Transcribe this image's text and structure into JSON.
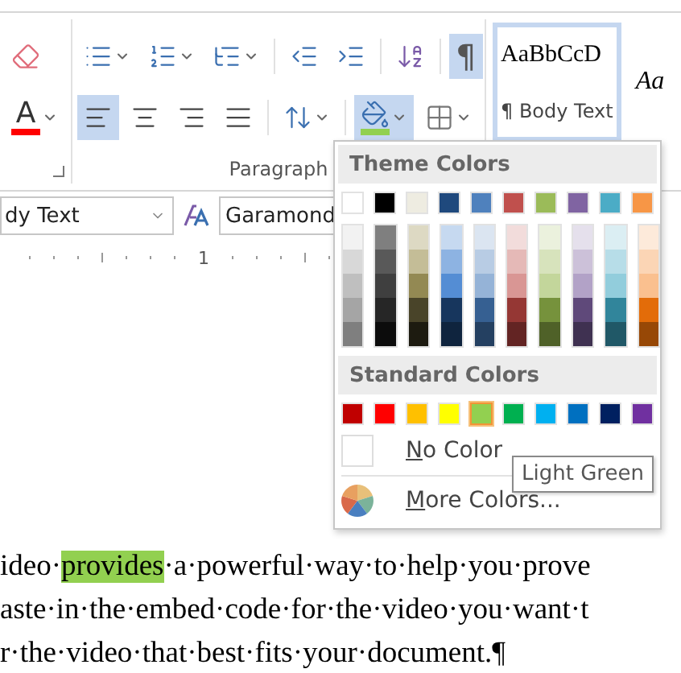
{
  "ribbon": {
    "left_group": {
      "row1": [
        {
          "kind": "clear_formatting",
          "selected": false
        }
      ],
      "row2": [
        {
          "kind": "font_color",
          "glyph": "A",
          "selected": false
        }
      ]
    },
    "paragraph_group": {
      "label": "Paragraph",
      "row1": [
        {
          "kind": "bullets",
          "selected": false
        },
        {
          "kind": "numbering",
          "selected": false
        },
        {
          "kind": "multilevel",
          "selected": false
        },
        {
          "kind": "decrease_indent",
          "selected": false
        },
        {
          "kind": "increase_indent",
          "selected": false
        },
        {
          "kind": "sort",
          "selected": false
        },
        {
          "kind": "show_hide",
          "glyph": "¶",
          "selected": true
        }
      ],
      "row2": [
        {
          "kind": "align_left",
          "selected": true
        },
        {
          "kind": "align_center",
          "selected": false
        },
        {
          "kind": "align_right",
          "selected": false
        },
        {
          "kind": "justify",
          "selected": false
        },
        {
          "kind": "line_spacing",
          "selected": false
        },
        {
          "kind": "shading",
          "selected": true
        },
        {
          "kind": "borders",
          "selected": false
        }
      ]
    },
    "styles": [
      {
        "preview": "AaBbCcD",
        "name": "¶ Body Text",
        "selected": true
      },
      {
        "preview": "Aa",
        "selected": false
      }
    ]
  },
  "font_row": {
    "style_box": "dy Text",
    "font_box": "Garamond"
  },
  "ruler": {
    "mark": "1"
  },
  "document": {
    "lines": [
      [
        {
          "text": "ideo·",
          "highlight": false
        },
        {
          "text": "provides",
          "highlight": true
        },
        {
          "text": "·a·powerful·way·to·help·you·prove",
          "highlight": false
        }
      ],
      [
        {
          "text": "aste·in·the·embed·code·for·the·video·you·want·t",
          "highlight": false
        }
      ],
      [
        {
          "text": "r·the·video·that·best·fits·your·document.¶",
          "highlight": false
        }
      ]
    ]
  },
  "color_menu": {
    "theme_title": "Theme Colors",
    "theme_colors": [
      {
        "color": "#ffffff",
        "shades": [
          {
            "color": "#f2f2f2"
          },
          {
            "color": "#d8d8d8"
          },
          {
            "color": "#bfbfbf"
          },
          {
            "color": "#a5a5a5"
          },
          {
            "color": "#7f7f7f"
          }
        ]
      },
      {
        "color": "#000000",
        "shades": [
          {
            "color": "#7f7f7f"
          },
          {
            "color": "#595959"
          },
          {
            "color": "#3f3f3f"
          },
          {
            "color": "#262626"
          },
          {
            "color": "#0c0c0c"
          }
        ]
      },
      {
        "color": "#eeece1",
        "shades": [
          {
            "color": "#ddd9c3"
          },
          {
            "color": "#c4bd97"
          },
          {
            "color": "#938953"
          },
          {
            "color": "#494429"
          },
          {
            "color": "#1d1b10"
          }
        ]
      },
      {
        "color": "#1f497d",
        "shades": [
          {
            "color": "#c6d9f0"
          },
          {
            "color": "#8db3e2"
          },
          {
            "color": "#548dd4"
          },
          {
            "color": "#17365d"
          },
          {
            "color": "#0f243e"
          }
        ]
      },
      {
        "color": "#4f81bd",
        "shades": [
          {
            "color": "#dbe5f1"
          },
          {
            "color": "#b8cce4"
          },
          {
            "color": "#95b3d7"
          },
          {
            "color": "#366092"
          },
          {
            "color": "#244061"
          }
        ]
      },
      {
        "color": "#c0504d",
        "shades": [
          {
            "color": "#f2dcdb"
          },
          {
            "color": "#e5b9b7"
          },
          {
            "color": "#d99694"
          },
          {
            "color": "#953734"
          },
          {
            "color": "#632423"
          }
        ]
      },
      {
        "color": "#9bbb59",
        "shades": [
          {
            "color": "#ebf1dd"
          },
          {
            "color": "#d7e3bc"
          },
          {
            "color": "#c3d69b"
          },
          {
            "color": "#76923c"
          },
          {
            "color": "#4f6128"
          }
        ]
      },
      {
        "color": "#8064a2",
        "shades": [
          {
            "color": "#e5e0ec"
          },
          {
            "color": "#ccc1d9"
          },
          {
            "color": "#b2a2c7"
          },
          {
            "color": "#5f497a"
          },
          {
            "color": "#3f3151"
          }
        ]
      },
      {
        "color": "#4bacc6",
        "shades": [
          {
            "color": "#dbeef3"
          },
          {
            "color": "#b7dde8"
          },
          {
            "color": "#92cddc"
          },
          {
            "color": "#31859b"
          },
          {
            "color": "#205867"
          }
        ]
      },
      {
        "color": "#f79646",
        "shades": [
          {
            "color": "#fdeada"
          },
          {
            "color": "#fbd5b5"
          },
          {
            "color": "#fac08f"
          },
          {
            "color": "#e36c09"
          },
          {
            "color": "#974806"
          }
        ]
      }
    ],
    "standard_title": "Standard Colors",
    "standard_colors": [
      {
        "color": "#c00000",
        "selected": false
      },
      {
        "color": "#ff0000",
        "selected": false
      },
      {
        "color": "#ffc000",
        "selected": false
      },
      {
        "color": "#ffff00",
        "selected": false
      },
      {
        "color": "#92d050",
        "selected": true
      },
      {
        "color": "#00b050",
        "selected": false
      },
      {
        "color": "#00b0f0",
        "selected": false
      },
      {
        "color": "#0070c0",
        "selected": false
      },
      {
        "color": "#002060",
        "selected": false
      },
      {
        "color": "#7030a0",
        "selected": false
      }
    ],
    "no_color": {
      "accel": "N",
      "rest": "o Color"
    },
    "more_colors": {
      "accel": "M",
      "rest": "ore Colors..."
    }
  },
  "tooltip": "Light Green"
}
